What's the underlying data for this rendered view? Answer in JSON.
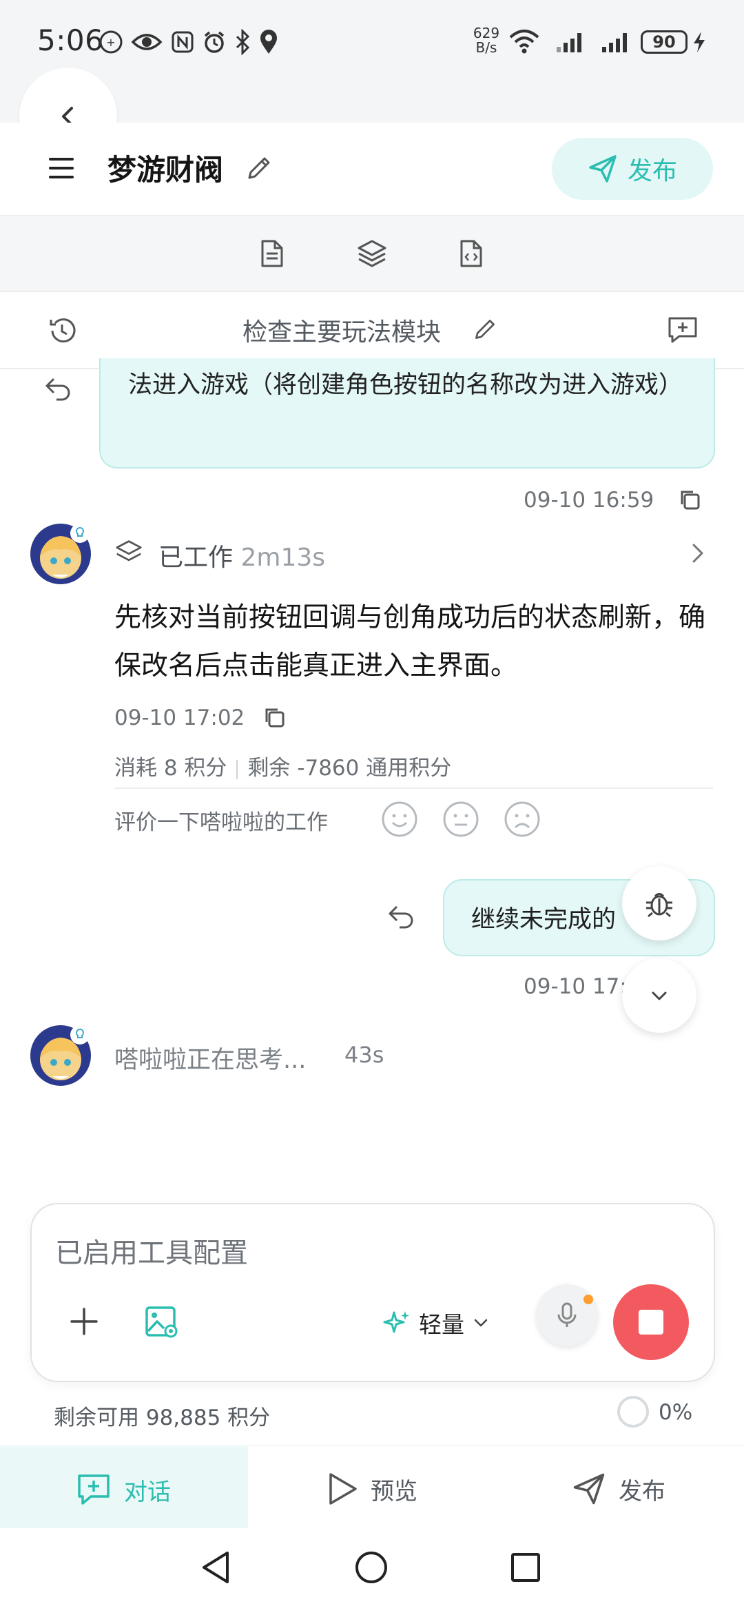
{
  "colors": {
    "accent": "#2bbdb0",
    "accent_bg": "#e4f8f7",
    "stop_red": "#f25a5f",
    "text_dark": "#1f1f1f",
    "text_gray": "#6e7378"
  },
  "status_bar": {
    "time": "5:06",
    "net_speed_value": "629",
    "net_speed_unit": "B/s",
    "battery": "90",
    "icons": [
      "app-badge-icon",
      "eye-icon",
      "nfc-icon",
      "alarm-icon",
      "bluetooth-icon",
      "location-icon",
      "wifi-icon",
      "signal-icon",
      "signal-icon",
      "battery-icon",
      "charging-icon"
    ]
  },
  "header": {
    "project_title": "梦游财阀",
    "publish_label": "发布"
  },
  "toolbar": {
    "icons": [
      "document-icon",
      "layers-icon",
      "code-file-icon"
    ]
  },
  "session": {
    "title": "检查主要玩法模块"
  },
  "messages": {
    "user_1": {
      "text": "法进入游戏（将创建角色按钮的名称改为进入游戏）",
      "timestamp": "09-10 16:59"
    },
    "assistant_1": {
      "worked_label": "已工作",
      "worked_duration": "2m13s",
      "text": "先核对当前按钮回调与创角成功后的状态刷新，确保改名后点击能真正进入主界面。",
      "timestamp": "09-10 17:02",
      "usage_consumed": "消耗 8 积分",
      "usage_remaining": "剩余 -7860 通用积分",
      "rate_prompt": "评价一下嗒啦啦的工作"
    },
    "user_2": {
      "text": "继续未完成的",
      "timestamp": "09-10 17:"
    },
    "assistant_thinking": {
      "text": "嗒啦啦正在思考...",
      "elapsed": "43s"
    }
  },
  "input": {
    "placeholder": "已启用工具配置",
    "model_label": "轻量"
  },
  "footer": {
    "remaining_credits": "剩余可用 98,885 积分",
    "progress_percent": "0%",
    "progress_value": 0
  },
  "bottom_nav": {
    "items": [
      {
        "label": "对话",
        "active": true
      },
      {
        "label": "预览",
        "active": false
      },
      {
        "label": "发布",
        "active": false
      }
    ]
  }
}
